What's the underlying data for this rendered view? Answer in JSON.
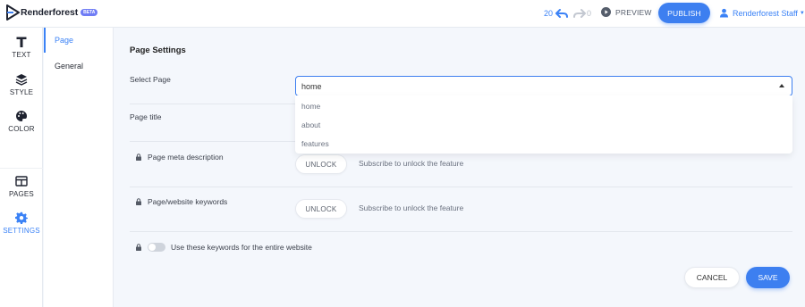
{
  "app": {
    "brand": "Renderforest",
    "badge": "BETA"
  },
  "toolbar": {
    "undo_count": "20",
    "redo_count": "0",
    "preview_label": "PREVIEW",
    "publish_label": "PUBLISH",
    "user_name": "Renderforest Staff"
  },
  "rail": {
    "items": [
      {
        "label": "TEXT",
        "icon": "text-icon"
      },
      {
        "label": "STYLE",
        "icon": "layers-icon"
      },
      {
        "label": "COLOR",
        "icon": "palette-icon"
      },
      {
        "label": "PAGES",
        "icon": "pages-icon"
      },
      {
        "label": "SETTINGS",
        "icon": "gear-icon"
      }
    ],
    "active": "SETTINGS"
  },
  "subnav": {
    "items": [
      {
        "label": "Page"
      },
      {
        "label": "General"
      }
    ],
    "active": "Page"
  },
  "settings": {
    "title": "Page Settings",
    "select_page_label": "Select Page",
    "select_page_value": "home",
    "page_options": [
      "home",
      "about",
      "features"
    ],
    "page_title_label": "Page title",
    "meta_description_label": "Page meta description",
    "keywords_label": "Page/website keywords",
    "unlock_label": "UNLOCK",
    "unlock_note": "Subscribe to unlock the feature",
    "toggle_label": "Use these keywords for the entire website",
    "toggle_on": false,
    "cancel_label": "CANCEL",
    "save_label": "SAVE"
  },
  "colors": {
    "accent": "#3d7ff0",
    "background": "#f4f7fc",
    "panel": "#ffffff"
  }
}
